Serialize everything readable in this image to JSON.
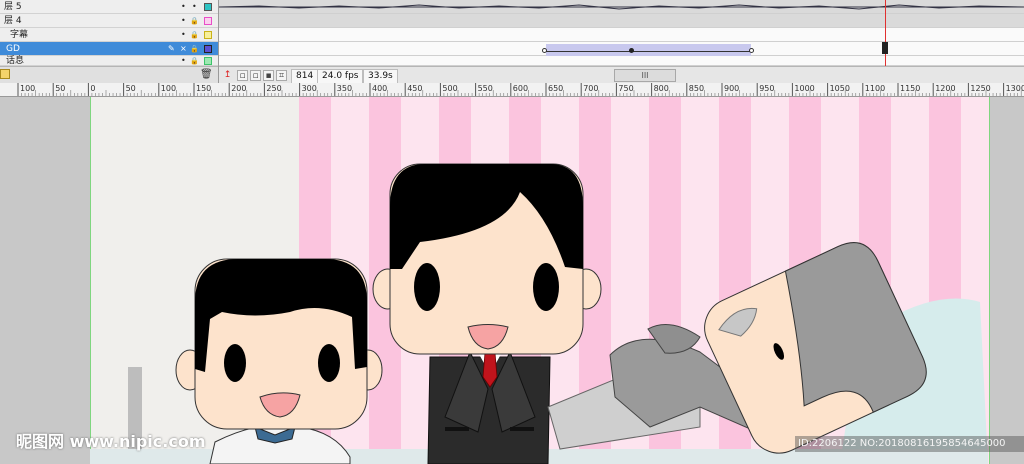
{
  "timeline": {
    "layers": [
      {
        "name": "层 5",
        "eye": "•",
        "lock": "•",
        "color": "#2ec4c4",
        "selected": false
      },
      {
        "name": "层 4",
        "eye": "•",
        "lock": "🔒",
        "color": "#e94ec8",
        "selected": false
      },
      {
        "name": "字幕",
        "eye": "•",
        "lock": "🔒",
        "color": "#e8d42c",
        "selected": false
      },
      {
        "name": "GD",
        "eye": "×",
        "lock": "🔒",
        "color": "#5a4fd1",
        "selected": true
      },
      {
        "name": "话息",
        "eye": "•",
        "lock": "🔒",
        "color": "#3cc46a",
        "selected": false
      }
    ],
    "current_frame": "814",
    "fps": "24.0 fps",
    "elapsed_time": "33.9s",
    "scroll_grip": "III"
  },
  "ruler": {
    "labels": [
      "100",
      "50",
      "0",
      "50",
      "100",
      "150",
      "200",
      "250",
      "300",
      "350",
      "400",
      "450",
      "500",
      "550",
      "600",
      "650",
      "700",
      "750",
      "800",
      "850",
      "900",
      "950",
      "1000",
      "1050",
      "1100",
      "1150",
      "1200",
      "1250",
      "1300"
    ]
  },
  "stage": {
    "stripe_color": "#fbc4de",
    "stripe_light": "#fde4ef",
    "skin_color": "#fde3cc",
    "hair_color": "#000000",
    "suit_color": "#2b2b2b",
    "tie_color": "#c0141c",
    "grey_color": "#9a9a9a"
  },
  "watermarks": {
    "left": "昵图网 www.nipic.com",
    "right": "ID:2206122 NO:20180816195854645000"
  }
}
